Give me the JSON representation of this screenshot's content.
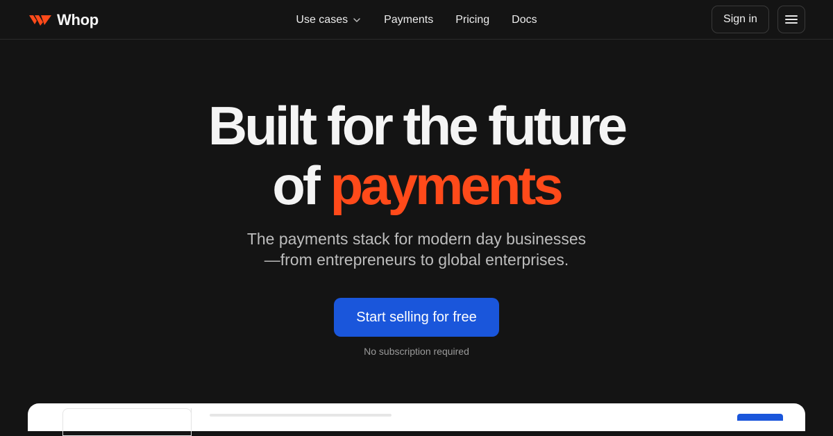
{
  "brand": {
    "name": "Whop",
    "logo_icon": "whop-logo-icon",
    "accent_color": "#ff4a1a"
  },
  "nav": {
    "links": [
      {
        "label": "Use cases",
        "has_dropdown": true
      },
      {
        "label": "Payments"
      },
      {
        "label": "Pricing"
      },
      {
        "label": "Docs"
      }
    ],
    "signin_label": "Sign in",
    "menu_icon": "hamburger-menu-icon"
  },
  "hero": {
    "headline_line1": "Built for the future",
    "headline_line2_prefix": "of",
    "headline_line2_accent": "payments",
    "subtitle_line1": "The payments stack for modern day businesses",
    "subtitle_line2": "—from entrepreneurs to global enterprises.",
    "cta_label": "Start selling for free",
    "cta_color": "#1a56db",
    "cta_note": "No subscription required"
  },
  "colors": {
    "background": "#141414",
    "headline": "#f4f4f4",
    "subtitle": "#bdbdbd"
  }
}
